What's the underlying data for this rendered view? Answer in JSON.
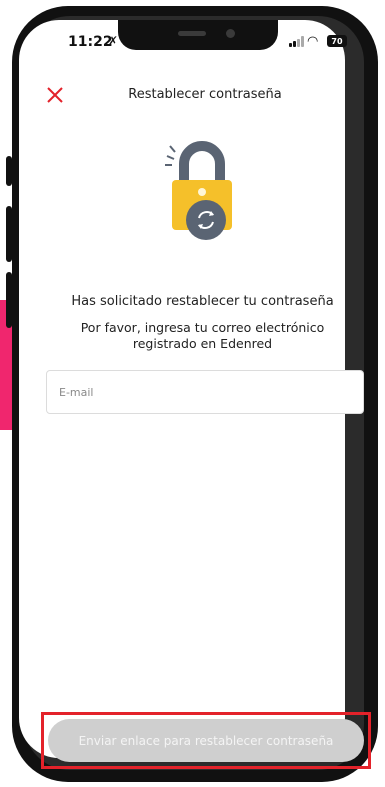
{
  "status_bar": {
    "time": "11:22",
    "battery": "70"
  },
  "header": {
    "title": "Restablecer contraseña"
  },
  "main": {
    "heading": "Has solicitado restablecer tu contraseña",
    "subtext": "Por favor, ingresa tu correo electrónico registrado en Edenred"
  },
  "form": {
    "email_placeholder": "E-mail",
    "email_value": ""
  },
  "actions": {
    "submit_label": "Enviar enlace para restablecer contraseña"
  },
  "colors": {
    "accent": "#e3222a",
    "lock_body": "#f5c02a",
    "lock_shackle": "#5a6473",
    "button_disabled": "#cfcfcf",
    "pointer": "#f0266e"
  },
  "icons": [
    "close-icon",
    "lock-icon",
    "refresh-icon",
    "signal-icon",
    "wifi-icon",
    "battery-icon",
    "mute-icon"
  ]
}
